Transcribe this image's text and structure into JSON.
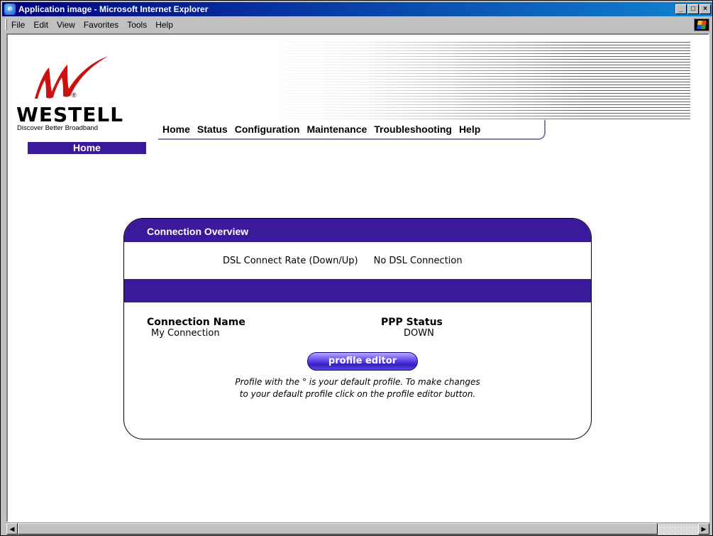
{
  "window": {
    "title": "Application image - Microsoft Internet Explorer",
    "controls": [
      "_",
      "□",
      "×"
    ]
  },
  "menubar": {
    "items": [
      {
        "label": "File"
      },
      {
        "label": "Edit"
      },
      {
        "label": "View"
      },
      {
        "label": "Favorites"
      },
      {
        "label": "Tools"
      },
      {
        "label": "Help"
      }
    ]
  },
  "brand": {
    "name": "WESTELL",
    "tagline": "Discover  Better  Broadband",
    "registered": "®",
    "accent_color": "#cc1111"
  },
  "nav": {
    "items": [
      "Home",
      "Status",
      "Configuration",
      "Maintenance",
      "Troubleshooting",
      "Help"
    ],
    "active_tab": "Home",
    "accent_color": "#3a1a9a"
  },
  "overview": {
    "header": "Connection Overview",
    "rate_label": "DSL Connect Rate (Down/Up)",
    "rate_value": "No DSL Connection",
    "connection_name_header": "Connection Name",
    "connection_name_value": "My Connection",
    "ppp_status_header": "PPP Status",
    "ppp_status_value": "DOWN",
    "profile_button": "profile editor",
    "note_line1": "Profile with the ° is your default profile. To make changes",
    "note_line2": "to your default profile click on the profile editor button."
  }
}
